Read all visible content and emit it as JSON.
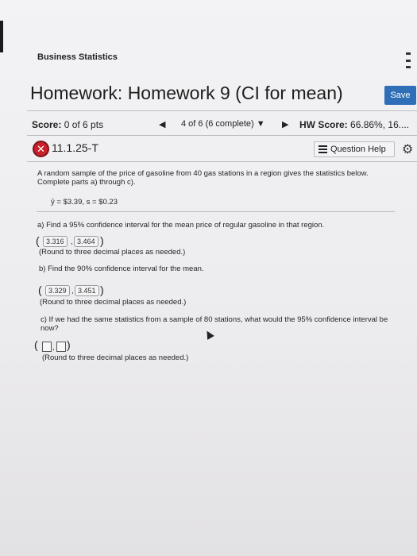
{
  "header": {
    "course": "Business Statistics",
    "title": "Homework: Homework 9 (CI for mean)",
    "save_label": "Save"
  },
  "nav": {
    "score_label": "Score:",
    "score_value": "0 of 6 pts",
    "position": "4 of 6 (6 complete)",
    "hw_score_label": "HW Score:",
    "hw_score_value": "66.86%, 16...."
  },
  "question": {
    "id": "11.1.25-T",
    "help_label": "Question Help",
    "prompt": "A random sample of the price of gasoline from 40 gas stations in a region gives the statistics below. Complete parts a) through c).",
    "statistics": "ȳ = $3.39, s = $0.23",
    "part_a": "a) Find a 95% confidence interval for the mean price of regular gasoline in that region.",
    "answer_a_low": "3.316",
    "answer_a_high": "3.464",
    "round_note_a": "(Round to three decimal places as needed.)",
    "part_b": "b) Find the 90% confidence interval for the mean.",
    "answer_b_low": "3.329",
    "answer_b_high": "3.451",
    "round_note_b": "(Round to three decimal places as needed.)",
    "part_c": "c) If we had the same statistics from a sample of 80 stations, what would the 95% confidence interval be now?",
    "round_note_c": "(Round to three decimal places as needed.)"
  },
  "icons": {
    "wrong_mark": "x-circle-icon",
    "menu": "menu-icon",
    "gear": "gear-icon",
    "help": "list-icon",
    "cursor": "cursor-icon"
  },
  "colors": {
    "save_button": "#2f6fb7",
    "wrong_mark": "#c9202a"
  }
}
